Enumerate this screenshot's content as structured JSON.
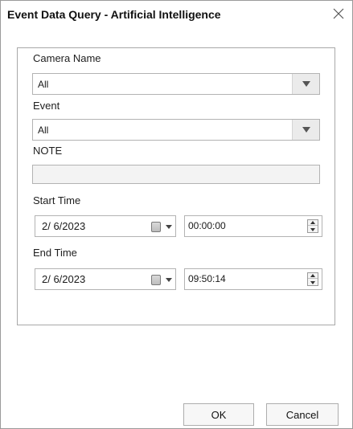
{
  "window": {
    "title": "Event Data Query - Artificial Intelligence",
    "close_glyph": "×"
  },
  "form": {
    "camera_name": {
      "label": "Camera Name",
      "value": "All"
    },
    "event": {
      "label": "Event",
      "value": "All"
    },
    "note": {
      "label": "NOTE",
      "value": ""
    },
    "start_time": {
      "label": "Start Time",
      "date": "2/ 6/2023",
      "time": "00:00:00"
    },
    "end_time": {
      "label": "End Time",
      "date": "2/ 6/2023",
      "time": "09:50:14"
    }
  },
  "buttons": {
    "ok": "OK",
    "cancel": "Cancel"
  },
  "icons": {
    "close": "close-icon",
    "dropdown": "triangle-down-icon",
    "calendar": "calendar-icon",
    "spin_up": "spin-up-icon",
    "spin_down": "spin-down-icon"
  },
  "colors": {
    "border": "#b3b3b3",
    "dropdown_bg": "#ebebeb",
    "note_bg": "#f3f3f3"
  }
}
